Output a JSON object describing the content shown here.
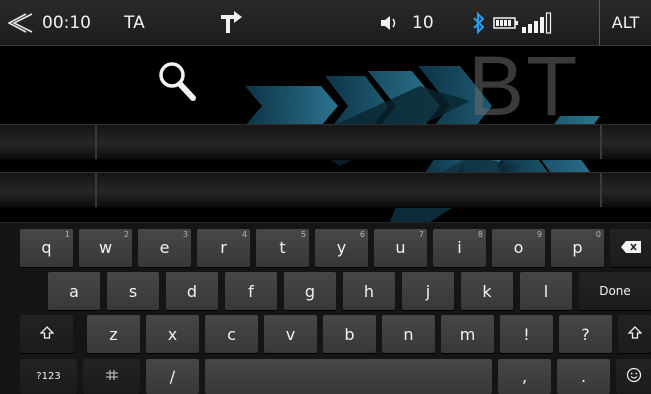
{
  "status_bar": {
    "time": "00:10",
    "ta": "TA",
    "volume": "10",
    "alt": "ALT"
  },
  "content": {
    "watermark": "BT"
  },
  "keyboard": {
    "row1": [
      {
        "label": "q",
        "hint": "1"
      },
      {
        "label": "w",
        "hint": "2"
      },
      {
        "label": "e",
        "hint": "3"
      },
      {
        "label": "r",
        "hint": "4"
      },
      {
        "label": "t",
        "hint": "5"
      },
      {
        "label": "y",
        "hint": "6"
      },
      {
        "label": "u",
        "hint": "7"
      },
      {
        "label": "i",
        "hint": "8"
      },
      {
        "label": "o",
        "hint": "9"
      },
      {
        "label": "p",
        "hint": "0"
      }
    ],
    "row2": [
      "a",
      "s",
      "d",
      "f",
      "g",
      "h",
      "j",
      "k",
      "l"
    ],
    "done": "Done",
    "row3": [
      "z",
      "x",
      "c",
      "v",
      "b",
      "n",
      "m",
      "!",
      "?"
    ],
    "symbols": "?123",
    "slash": "/",
    "comma": ",",
    "period": "."
  },
  "icons": {
    "back": "back-chevron-icon",
    "navigation": "turn-right-icon",
    "volume": "speaker-icon",
    "bluetooth": "bluetooth-icon",
    "battery": "battery-icon",
    "signal": "signal-icon",
    "search": "search-icon",
    "backspace": "backspace-icon",
    "shift": "shift-icon",
    "keyboard_settings": "keyboard-settings-icon",
    "emoji": "emoji-icon"
  }
}
